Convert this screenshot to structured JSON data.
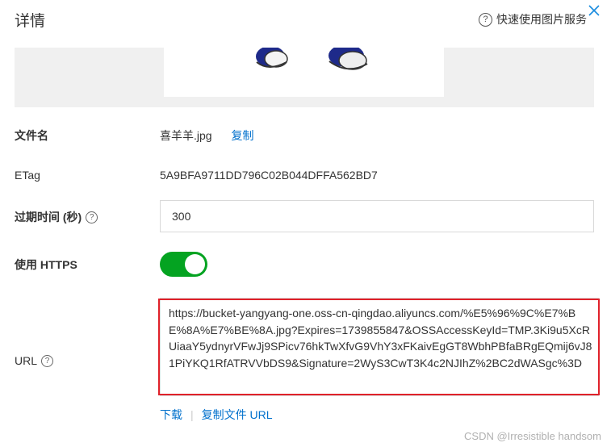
{
  "panel": {
    "title": "详情",
    "help_label": "快速使用图片服务",
    "help_icon": "question-circle-icon",
    "close_icon": "close-icon"
  },
  "preview": {
    "image_alt": "preview-image"
  },
  "fields": {
    "filename": {
      "label": "文件名",
      "value": "喜羊羊.jpg",
      "copy_label": "复制"
    },
    "etag": {
      "label": "ETag",
      "value": "5A9BFA9711DD796C02B044DFFA562BD7"
    },
    "expires": {
      "label": "过期时间 (秒)",
      "value": "300"
    },
    "https": {
      "label": "使用 HTTPS",
      "enabled": true
    },
    "url": {
      "label": "URL",
      "value": "https://bucket-yangyang-one.oss-cn-qingdao.aliyuncs.com/%E5%96%9C%E7%BE%8A%E7%BE%8A.jpg?Expires=1739855847&OSSAccessKeyId=TMP.3Ki9u5XcRUiaaY5ydnyrVFwJj9SPicv76hkTwXfvG9VhY3xFKaivEgGT8WbhPBfaBRgEQmij6vJ81PiYKQ1RfATRVVbDS9&Signature=2WyS3CwT3K4c2NJIhZ%2BC2dWASgc%3D",
      "download_label": "下载",
      "copy_url_label": "复制文件 URL"
    }
  },
  "watermark": "CSDN @Irresistible handsom",
  "colors": {
    "toggle_on": "#04a321",
    "link": "#0070cc",
    "highlight": "#e0212a"
  }
}
